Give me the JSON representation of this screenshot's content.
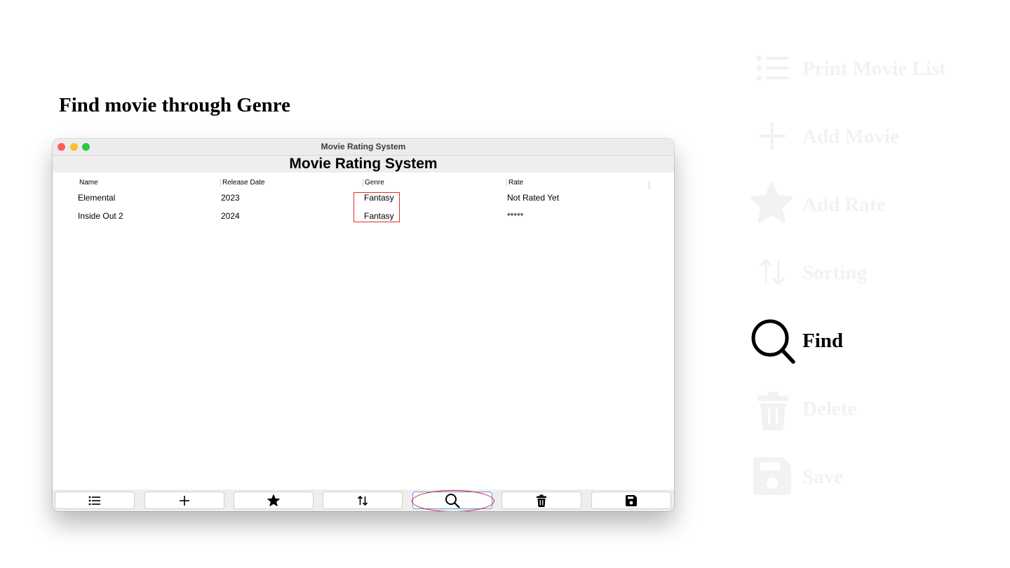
{
  "page": {
    "heading": "Find movie through Genre"
  },
  "window": {
    "title": "Movie Rating System",
    "app_header": "Movie Rating System",
    "table": {
      "columns": [
        "Name",
        "Release Date",
        "Genre",
        "Rate"
      ],
      "rows": [
        [
          "Elemental",
          "2023",
          "Fantasy",
          "Not Rated Yet"
        ],
        [
          "Inside Out 2",
          "2024",
          "Fantasy",
          "*****"
        ]
      ]
    },
    "toolbar": {
      "buttons": [
        {
          "name": "list-button",
          "icon": "list-icon"
        },
        {
          "name": "add-button",
          "icon": "plus-icon"
        },
        {
          "name": "rate-button",
          "icon": "star-icon"
        },
        {
          "name": "sort-button",
          "icon": "sort-arrows-icon"
        },
        {
          "name": "find-button",
          "icon": "search-icon",
          "active": true
        },
        {
          "name": "delete-button",
          "icon": "trash-icon"
        },
        {
          "name": "save-button",
          "icon": "floppy-disk-icon"
        }
      ]
    }
  },
  "legend": {
    "items": [
      {
        "label": "Print Movie List",
        "icon": "list-icon",
        "state": "faded"
      },
      {
        "label": "Add Movie",
        "icon": "plus-icon",
        "state": "faded"
      },
      {
        "label": "Add Rate",
        "icon": "star-icon",
        "state": "faded"
      },
      {
        "label": "Sorting",
        "icon": "sort-arrows-icon",
        "state": "faded"
      },
      {
        "label": "Find",
        "icon": "search-icon",
        "state": "current"
      },
      {
        "label": "Delete",
        "icon": "trash-icon",
        "state": "faded"
      },
      {
        "label": "Save",
        "icon": "floppy-disk-icon",
        "state": "faded"
      }
    ]
  },
  "colors": {
    "highlight": "#e0302a",
    "active_border": "#5b9df5",
    "faded": "#f2f2f2",
    "traffic_close": "#fe5f57",
    "traffic_min": "#febc2e",
    "traffic_max": "#28c840"
  }
}
